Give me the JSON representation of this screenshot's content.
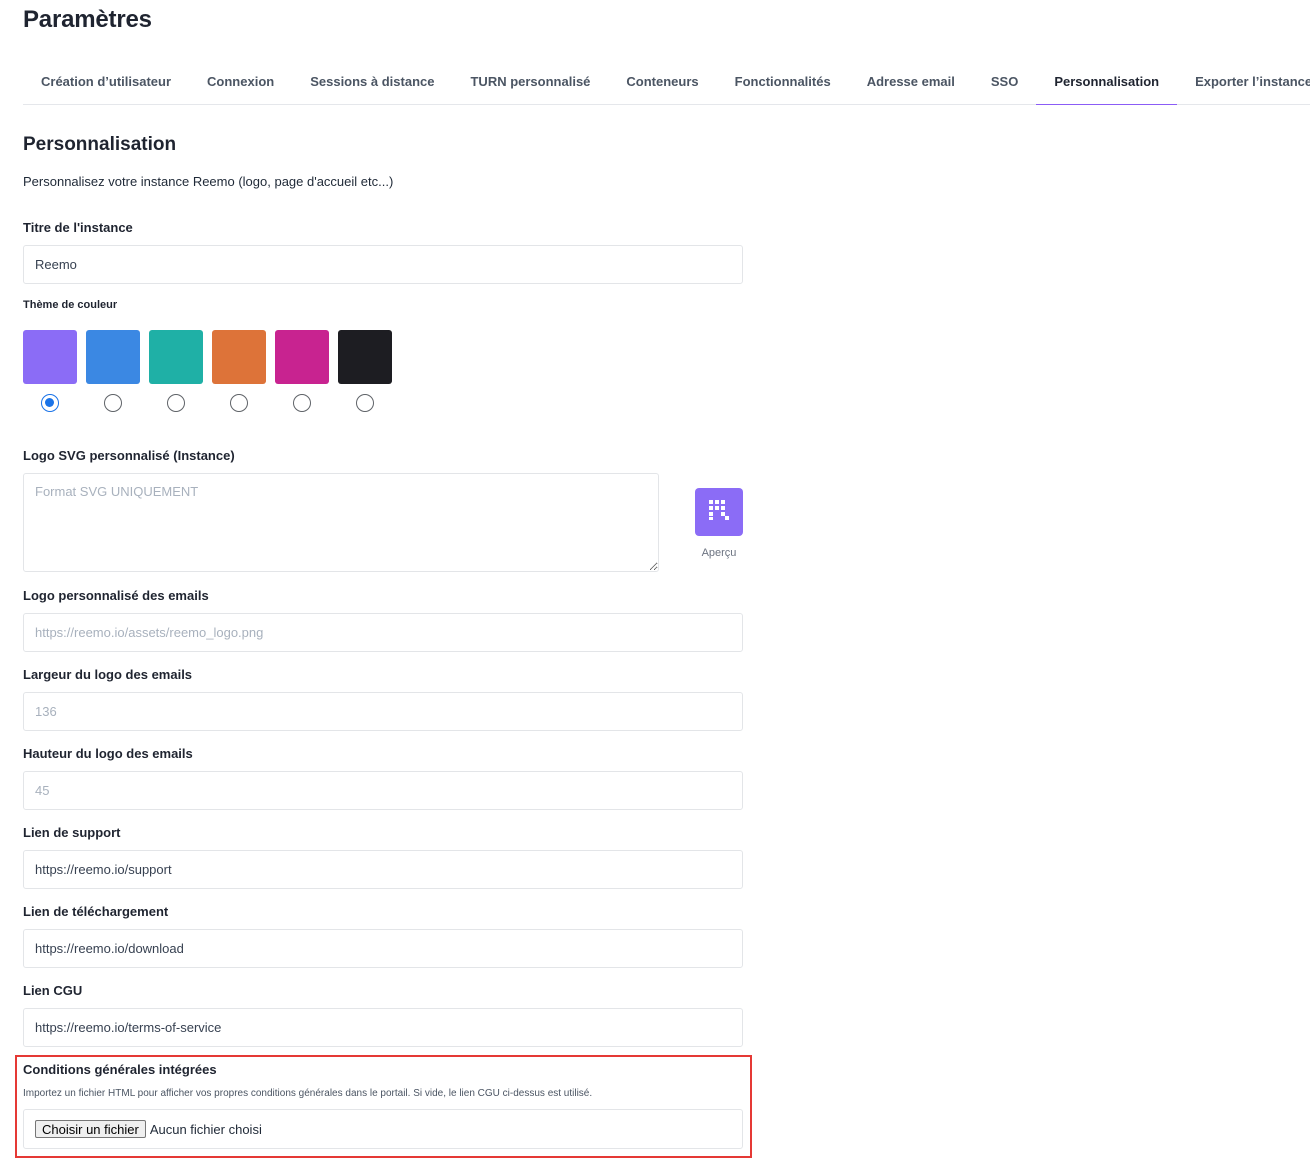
{
  "page": {
    "title": "Paramètres"
  },
  "tabs": [
    {
      "label": "Création d’utilisateur"
    },
    {
      "label": "Connexion"
    },
    {
      "label": "Sessions à distance"
    },
    {
      "label": "TURN personnalisé"
    },
    {
      "label": "Conteneurs"
    },
    {
      "label": "Fonctionnalités"
    },
    {
      "label": "Adresse email"
    },
    {
      "label": "SSO"
    },
    {
      "label": "Personnalisation",
      "active": true
    },
    {
      "label": "Exporter l’instance"
    }
  ],
  "section": {
    "title": "Personnalisation",
    "description": "Personnalisez votre instance Reemo (logo, page d'accueil etc...)"
  },
  "instance_title": {
    "label": "Titre de l'instance",
    "value": "Reemo"
  },
  "color_theme": {
    "label": "Thème de couleur",
    "selected_index": 0,
    "swatches": [
      {
        "color": "#8b6cf6"
      },
      {
        "color": "#3b88e3"
      },
      {
        "color": "#1fb0a6"
      },
      {
        "color": "#dd7339"
      },
      {
        "color": "#c82390"
      },
      {
        "color": "#1d1d22"
      }
    ]
  },
  "svg_logo": {
    "label": "Logo SVG personnalisé (Instance)",
    "placeholder": "Format SVG UNIQUEMENT",
    "preview_label": "Aperçu",
    "preview_icon": "reemo-logo-icon",
    "preview_color": "#8b6cf6"
  },
  "email_logo": {
    "label": "Logo personnalisé des emails",
    "placeholder": "https://reemo.io/assets/reemo_logo.png"
  },
  "email_logo_width": {
    "label": "Largeur du logo des emails",
    "placeholder": "136"
  },
  "email_logo_height": {
    "label": "Hauteur du logo des emails",
    "placeholder": "45"
  },
  "support_link": {
    "label": "Lien de support",
    "value": "https://reemo.io/support"
  },
  "download_link": {
    "label": "Lien de téléchargement",
    "value": "https://reemo.io/download"
  },
  "cgu_link": {
    "label": "Lien CGU",
    "value": "https://reemo.io/terms-of-service"
  },
  "embedded_terms": {
    "label": "Conditions générales intégrées",
    "description": "Importez un fichier HTML pour afficher vos propres conditions générales dans le portail. Si vide, le lien CGU ci-dessus est utilisé.",
    "button_label": "Choisir un fichier",
    "status": "Aucun fichier choisi"
  },
  "highlight_color": "#e53935"
}
